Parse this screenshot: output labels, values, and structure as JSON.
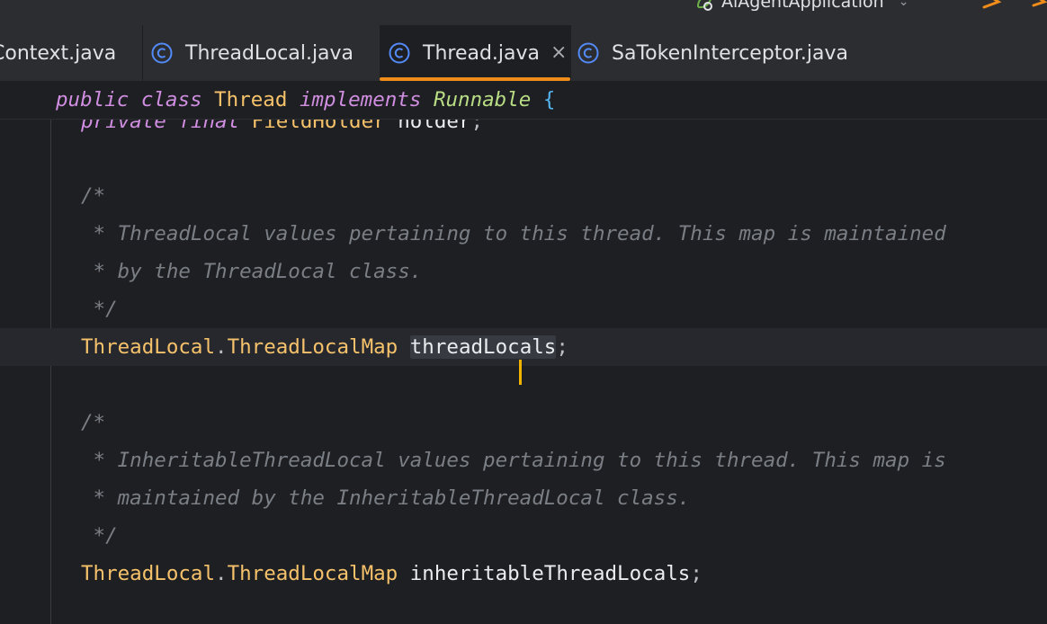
{
  "run_config": {
    "label": "AiAgentApplication"
  },
  "tabs": [
    {
      "label": "Context.java",
      "active": false,
      "icon": "class-icon"
    },
    {
      "label": "ThreadLocal.java",
      "active": false,
      "icon": "class-icon"
    },
    {
      "label": "Thread.java",
      "active": true,
      "icon": "class-icon",
      "close": "×"
    },
    {
      "label": "SaTokenInterceptor.java",
      "active": false,
      "icon": "class-icon"
    }
  ],
  "colors": {
    "accent": "#f08c1a",
    "caret": "#f0b400",
    "keyword": "#cf8ee0",
    "class": "#f5c26b",
    "interface": "#b9dd85",
    "comment": "#7a7e85",
    "background": "#1e1f22"
  },
  "editor": {
    "sticky": {
      "kw1": "public",
      "kw2": "class",
      "class_name": "Thread",
      "kw3": "implements",
      "iface": "Runnable",
      "brace": "{"
    },
    "cut_line": {
      "kw1": "private",
      "kw2": "final",
      "type": "FieldHolder",
      "name": "holder",
      "semi": ";"
    },
    "block1": {
      "open": "/*",
      "l1": " * ThreadLocal values pertaining to this thread. This map is maintained",
      "l2": " * by the ThreadLocal class.",
      "close": " */"
    },
    "decl1": {
      "outer": "ThreadLocal",
      "dot": ".",
      "inner": "ThreadLocalMap",
      "name_before_caret": "threadLoc",
      "name_after_caret": "als",
      "semi": ";"
    },
    "block2": {
      "open": "/*",
      "l1": " * InheritableThreadLocal values pertaining to this thread. This map is",
      "l2": " * maintained by the InheritableThreadLocal class.",
      "close": " */"
    },
    "decl2": {
      "outer": "ThreadLocal",
      "dot": ".",
      "inner": "ThreadLocalMap",
      "name": "inheritableThreadLocals",
      "semi": ";"
    }
  }
}
